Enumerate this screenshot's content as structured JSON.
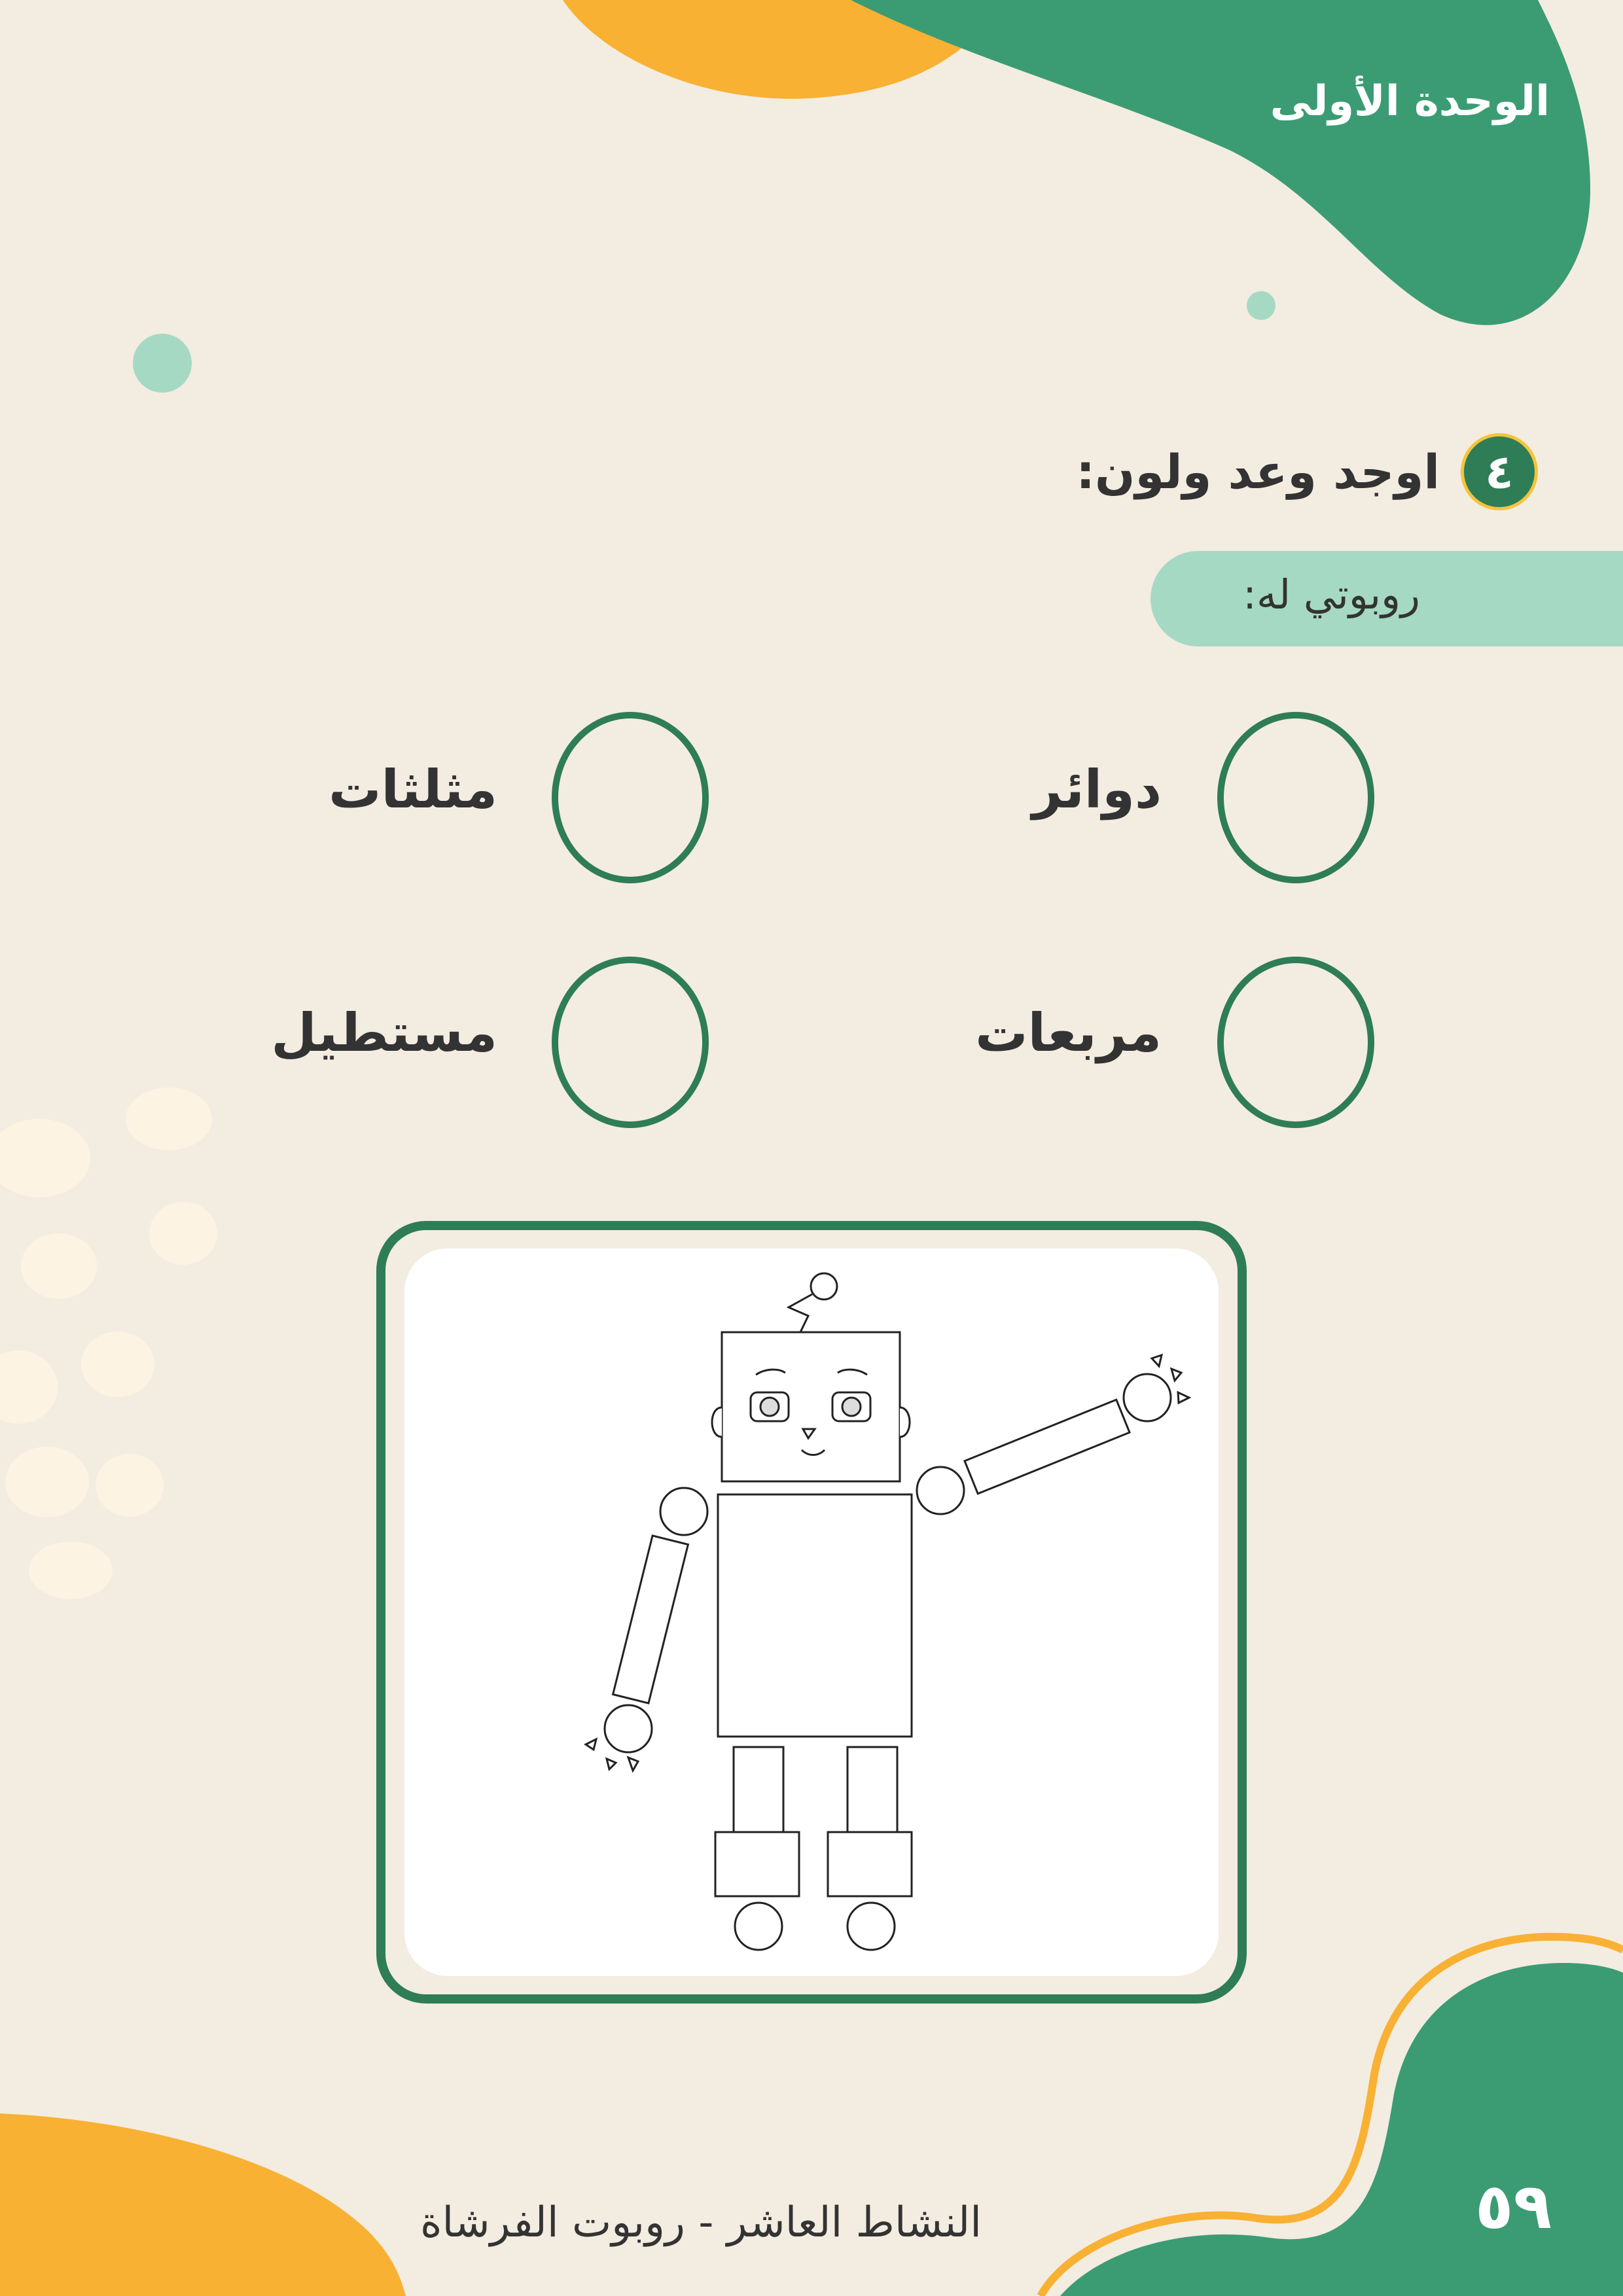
{
  "header": {
    "unit_title": "الوحدة الأولى"
  },
  "task": {
    "number": "٤",
    "title": "اوجد وعد ولون:"
  },
  "prompt": {
    "text": "روبوتي له:"
  },
  "shapes": [
    {
      "id": "circles",
      "label": "دوائر"
    },
    {
      "id": "triangles",
      "label": "مثلثات"
    },
    {
      "id": "squares",
      "label": "مربعات"
    },
    {
      "id": "rectangle",
      "label": "مستطيل"
    }
  ],
  "footer": {
    "activity": "النشاط العاشر - روبوت الفرشاة",
    "page_number": "٥٩"
  },
  "colors": {
    "background": "#f3ece1",
    "green": "#3b9c74",
    "dark_green": "#2e7d57",
    "orange": "#f8b133",
    "mint": "#a5d9c4",
    "cream_dots": "#fdf3e3",
    "text": "#333333"
  }
}
